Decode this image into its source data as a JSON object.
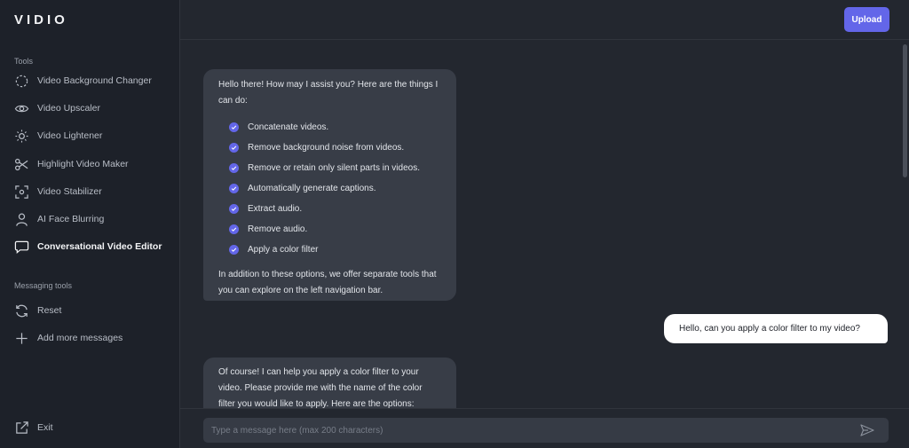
{
  "app": {
    "logo": "VIDIO"
  },
  "sidebar": {
    "tools_label": "Tools",
    "tools": [
      {
        "label": "Video Background Changer",
        "icon": "dashed-circle-icon"
      },
      {
        "label": "Video Upscaler",
        "icon": "eye-icon"
      },
      {
        "label": "Video Lightener",
        "icon": "sun-icon"
      },
      {
        "label": "Highlight Video Maker",
        "icon": "scissors-icon"
      },
      {
        "label": "Video Stabilizer",
        "icon": "focus-frame-icon"
      },
      {
        "label": "AI Face Blurring",
        "icon": "person-icon"
      },
      {
        "label": "Conversational Video Editor",
        "icon": "chat-bubble-icon",
        "active": true
      }
    ],
    "messaging_label": "Messaging tools",
    "messaging": [
      {
        "label": "Reset",
        "icon": "refresh-icon"
      },
      {
        "label": "Add more messages",
        "icon": "plus-icon"
      }
    ],
    "exit_label": "Exit"
  },
  "header": {
    "upload_label": "Upload"
  },
  "chat": {
    "bot_message_1": {
      "intro": "Hello there! How may I assist you? Here are the things I can do:",
      "items": [
        "Concatenate videos.",
        "Remove background noise from videos.",
        "Remove or retain only silent parts in videos.",
        "Automatically generate captions.",
        "Extract audio.",
        "Remove audio.",
        "Apply a color filter"
      ],
      "outro": "In addition to these options, we offer separate tools that you can explore on the left navigation bar."
    },
    "user_message": "Hello, can you apply a color filter to my video?",
    "bot_message_2": "Of course! I can help you apply a color filter to your video. Please provide me with the name of the color filter you would like to apply. Here are the options:"
  },
  "composer": {
    "placeholder": "Type a message here (max 200 characters)"
  },
  "colors": {
    "accent": "#6366e9",
    "sidebar_bg": "#1d2129",
    "main_bg": "#23272f",
    "bubble_bg": "#383d47"
  }
}
